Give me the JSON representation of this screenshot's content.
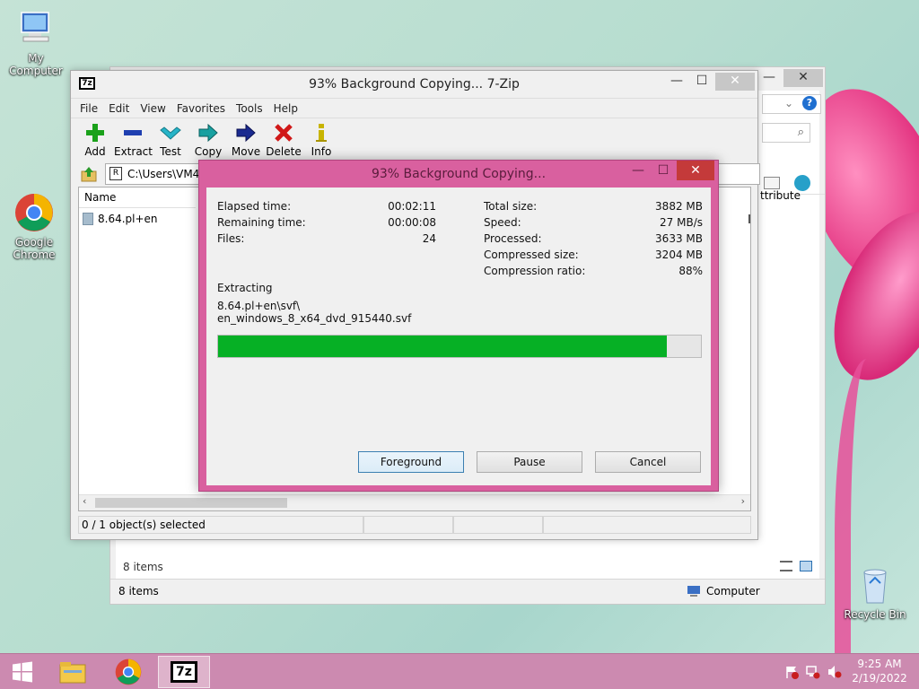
{
  "desktop": {
    "icons": [
      {
        "label": "My Computer",
        "icon": "computer-icon"
      },
      {
        "label": "Google Chrome",
        "icon": "chrome-icon"
      },
      {
        "label": "Recycle Bin",
        "icon": "recycle-bin-icon"
      }
    ]
  },
  "explorer": {
    "status_items": "8 items",
    "content_items": "8 items",
    "status_location": "Computer",
    "column_partial": "ttribute",
    "controls": {
      "minimize": "—",
      "maximize": "☐",
      "close": "✕"
    }
  },
  "zip": {
    "title": "93% Background Copying... 7-Zip",
    "app_icon": "7z",
    "controls": {
      "minimize": "—",
      "maximize": "☐",
      "close": "✕"
    },
    "menu": [
      "File",
      "Edit",
      "View",
      "Favorites",
      "Tools",
      "Help"
    ],
    "toolbar": [
      {
        "label": "Add",
        "icon": "plus-icon",
        "color": "#1aa11a"
      },
      {
        "label": "Extract",
        "icon": "minus-icon",
        "color": "#1f3fb0"
      },
      {
        "label": "Test",
        "icon": "check-icon",
        "color": "#26b4c8"
      },
      {
        "label": "Copy",
        "icon": "copy-arrow-icon",
        "color": "#18a0a0"
      },
      {
        "label": "Move",
        "icon": "move-arrow-icon",
        "color": "#1a2a90"
      },
      {
        "label": "Delete",
        "icon": "delete-x-icon",
        "color": "#d01818"
      },
      {
        "label": "Info",
        "icon": "info-icon",
        "color": "#c8b400"
      }
    ],
    "address": "C:\\Users\\VM4\\",
    "list": {
      "column_name": "Name",
      "items": [
        {
          "name": "8.64.pl+en"
        }
      ]
    },
    "status": {
      "selection": "0 / 1 object(s) selected"
    }
  },
  "dialog": {
    "title": "93% Background Copying...",
    "controls": {
      "minimize": "—",
      "maximize": "☐",
      "close": "✕"
    },
    "left_stats": [
      {
        "label": "Elapsed time:",
        "value": "00:02:11"
      },
      {
        "label": "Remaining time:",
        "value": "00:00:08"
      },
      {
        "label": "Files:",
        "value": "24"
      }
    ],
    "right_stats": [
      {
        "label": "Total size:",
        "value": "3882 MB"
      },
      {
        "label": "Speed:",
        "value": "27 MB/s"
      },
      {
        "label": "Processed:",
        "value": "3633 MB"
      },
      {
        "label": "Compressed size:",
        "value": "3204 MB"
      },
      {
        "label": "Compression ratio:",
        "value": "88%"
      }
    ],
    "operation": "Extracting",
    "current_file_line1": "8.64.pl+en\\svf\\",
    "current_file_line2": "en_windows_8_x64_dvd_915440.svf",
    "progress": 0.93,
    "progress_color": "#06b025",
    "buttons": {
      "foreground": "Foreground",
      "pause": "Pause",
      "cancel": "Cancel"
    }
  },
  "taskbar": {
    "time": "9:25 AM",
    "date": "2/19/2022",
    "items": [
      {
        "icon": "windows-start-icon"
      },
      {
        "icon": "file-explorer-icon"
      },
      {
        "icon": "chrome-icon"
      },
      {
        "icon": "7zip-icon",
        "label": "7z",
        "active": true
      }
    ]
  }
}
